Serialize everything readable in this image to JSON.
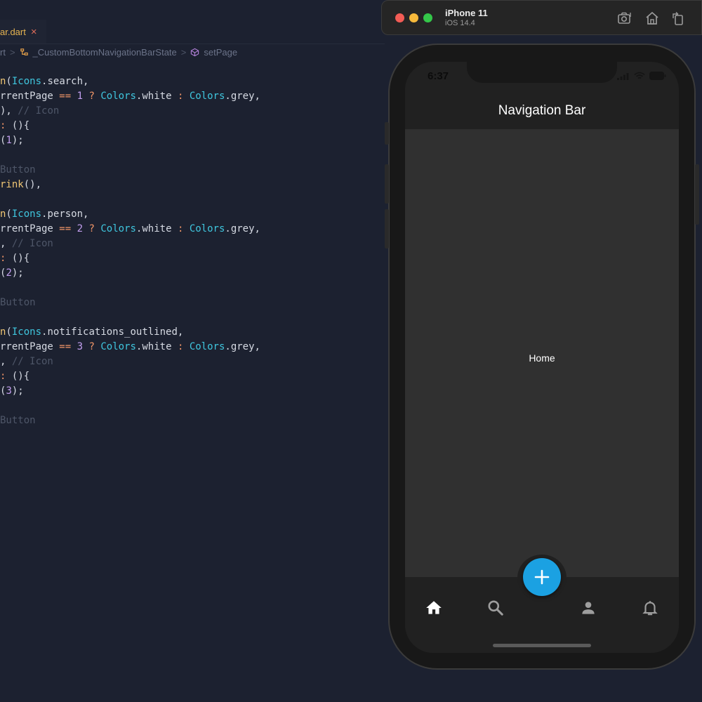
{
  "editor": {
    "tab": {
      "label": "ar.dart",
      "close_glyph": "×"
    },
    "breadcrumb": {
      "items": [
        "rt",
        "_CustomBottomNavigationBarState",
        "setPage"
      ],
      "separator": ">"
    },
    "code_lines": [
      [
        [
          "fn",
          "n"
        ],
        [
          "pn",
          "("
        ],
        [
          "cls",
          "Icons"
        ],
        [
          "pn",
          ".search,"
        ]
      ],
      [
        [
          "pn",
          "rrentPage "
        ],
        [
          "op",
          "=="
        ],
        [
          "pn",
          " "
        ],
        [
          "num",
          "1"
        ],
        [
          "pn",
          " "
        ],
        [
          "op",
          "?"
        ],
        [
          "pn",
          " "
        ],
        [
          "cls",
          "Colors"
        ],
        [
          "pn",
          ".white "
        ],
        [
          "op",
          ":"
        ],
        [
          "pn",
          " "
        ],
        [
          "cls",
          "Colors"
        ],
        [
          "pn",
          ".grey,"
        ]
      ],
      [
        [
          "pn",
          "), "
        ],
        [
          "cm",
          "// Icon"
        ]
      ],
      [
        [
          "op",
          ":"
        ],
        [
          "pn",
          " (){"
        ]
      ],
      [
        [
          "pn",
          "("
        ],
        [
          "num",
          "1"
        ],
        [
          "pn",
          ");"
        ]
      ],
      [],
      [
        [
          "cm",
          "Button"
        ]
      ],
      [
        [
          "fn",
          "rink"
        ],
        [
          "pn",
          "(),"
        ]
      ],
      [],
      [
        [
          "fn",
          "n"
        ],
        [
          "pn",
          "("
        ],
        [
          "cls",
          "Icons"
        ],
        [
          "pn",
          ".person,"
        ]
      ],
      [
        [
          "pn",
          "rrentPage "
        ],
        [
          "op",
          "=="
        ],
        [
          "pn",
          " "
        ],
        [
          "num",
          "2"
        ],
        [
          "pn",
          " "
        ],
        [
          "op",
          "?"
        ],
        [
          "pn",
          " "
        ],
        [
          "cls",
          "Colors"
        ],
        [
          "pn",
          ".white "
        ],
        [
          "op",
          ":"
        ],
        [
          "pn",
          " "
        ],
        [
          "cls",
          "Colors"
        ],
        [
          "pn",
          ".grey,"
        ]
      ],
      [
        [
          "pn",
          ", "
        ],
        [
          "cm",
          "// Icon"
        ]
      ],
      [
        [
          "op",
          ":"
        ],
        [
          "pn",
          " (){"
        ]
      ],
      [
        [
          "pn",
          "("
        ],
        [
          "num",
          "2"
        ],
        [
          "pn",
          ");"
        ]
      ],
      [],
      [
        [
          "cm",
          "Button"
        ]
      ],
      [],
      [
        [
          "fn",
          "n"
        ],
        [
          "pn",
          "("
        ],
        [
          "cls",
          "Icons"
        ],
        [
          "pn",
          ".notifications_outlined,"
        ]
      ],
      [
        [
          "pn",
          "rrentPage "
        ],
        [
          "op",
          "=="
        ],
        [
          "pn",
          " "
        ],
        [
          "num",
          "3"
        ],
        [
          "pn",
          " "
        ],
        [
          "op",
          "?"
        ],
        [
          "pn",
          " "
        ],
        [
          "cls",
          "Colors"
        ],
        [
          "pn",
          ".white "
        ],
        [
          "op",
          ":"
        ],
        [
          "pn",
          " "
        ],
        [
          "cls",
          "Colors"
        ],
        [
          "pn",
          ".grey,"
        ]
      ],
      [
        [
          "pn",
          ", "
        ],
        [
          "cm",
          "// Icon"
        ]
      ],
      [
        [
          "op",
          ":"
        ],
        [
          "pn",
          " (){"
        ]
      ],
      [
        [
          "pn",
          "("
        ],
        [
          "num",
          "3"
        ],
        [
          "pn",
          ");"
        ]
      ],
      [],
      [
        [
          "cm",
          "Button"
        ]
      ]
    ]
  },
  "simulator": {
    "device_name": "iPhone 11",
    "os_version": "iOS 14.4",
    "toolbar_icons": [
      "screenshot-icon",
      "home-icon",
      "rotate-icon"
    ]
  },
  "app": {
    "status_time": "6:37",
    "appbar_title": "Navigation Bar",
    "body_text": "Home",
    "fab_icon": "plus-icon",
    "nav_items": [
      {
        "icon": "home-icon",
        "active": true
      },
      {
        "icon": "search-icon",
        "active": false
      },
      {
        "icon": "person-icon",
        "active": false
      },
      {
        "icon": "notifications-outlined-icon",
        "active": false
      }
    ],
    "colors": {
      "active_icon": "#ffffff",
      "inactive_icon": "#9e9e9e",
      "fab": "#1ba1e2",
      "appbar": "#212121",
      "body": "#303030"
    }
  }
}
